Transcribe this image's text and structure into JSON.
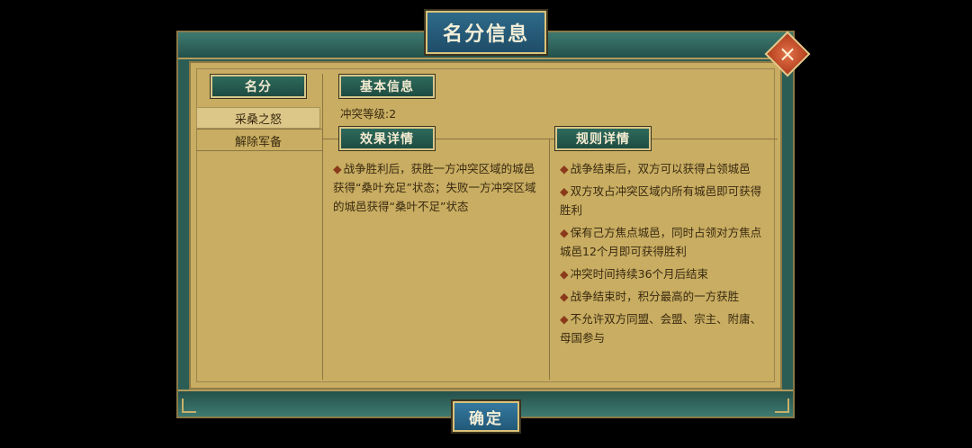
{
  "window": {
    "title": "名分信息",
    "close_label": "×",
    "confirm_label": "确定"
  },
  "sidebar": {
    "header": "名分",
    "items": [
      {
        "label": "采桑之怒",
        "selected": true
      },
      {
        "label": "解除军备",
        "selected": false
      }
    ]
  },
  "basic_info": {
    "header": "基本信息",
    "conflict_level": "冲突等级:2"
  },
  "effects": {
    "header": "效果详情",
    "paragraphs": [
      "战争胜利后，获胜一方冲突区域的城邑获得“桑叶充足”状态；失败一方冲突区域的城邑获得“桑叶不足”状态"
    ]
  },
  "rules": {
    "header": "规则详情",
    "paragraphs": [
      "战争结束后，双方可以获得占领城邑",
      "双方攻占冲突区域内所有城邑即可获得胜利",
      "保有己方焦点城邑，同时占领对方焦点城邑12个月即可获得胜利",
      "冲突时间持续36个月后结束",
      "战争结束时，积分最高的一方获胜",
      "不允许双方同盟、会盟、宗主、附庸、母国参与"
    ]
  },
  "colors": {
    "frame": "#2b5d55",
    "parchment": "#c8ad62",
    "accent_gold": "#d9c27a",
    "bullet": "#8a3a1a"
  }
}
